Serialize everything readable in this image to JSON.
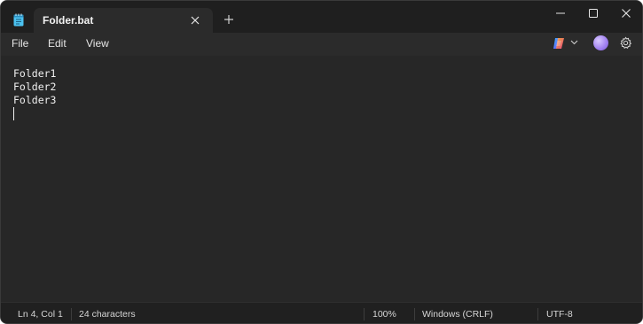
{
  "tab": {
    "title": "Folder.bat"
  },
  "menu": {
    "file": "File",
    "edit": "Edit",
    "view": "View"
  },
  "editor": {
    "lines": [
      "Folder1",
      "Folder2",
      "Folder3"
    ]
  },
  "status": {
    "position": "Ln 4, Col 1",
    "characters": "24 characters",
    "zoom": "100%",
    "line_endings": "Windows (CRLF)",
    "encoding": "UTF-8"
  },
  "icons": {
    "app": "notepad-icon",
    "tab_close": "close-icon",
    "new_tab": "plus-icon",
    "minimize": "minimize-icon",
    "maximize": "maximize-icon",
    "close": "close-icon",
    "copilot": "copilot-icon",
    "settings": "gear-icon"
  },
  "colors": {
    "window_bg": "#272727",
    "titlebar_bg": "#1f1f1f",
    "statusbar_bg": "#202020",
    "text": "#f0f0f0",
    "app_icon_accent": "#4cc2f0"
  }
}
